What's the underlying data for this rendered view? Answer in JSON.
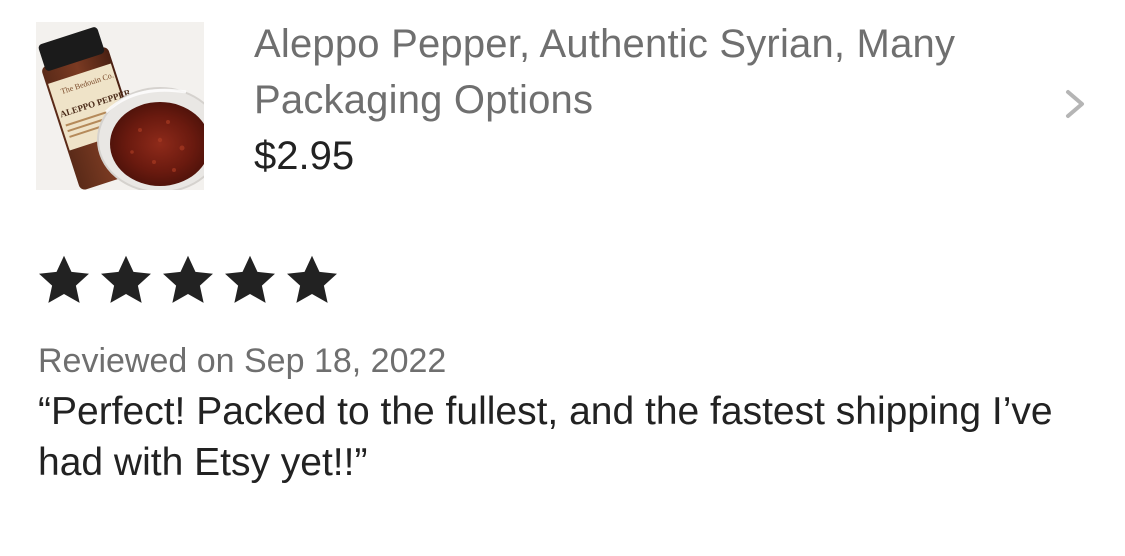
{
  "listing": {
    "title": "Aleppo Pepper, Authentic Syrian, Many Packaging Options",
    "price": "$2.95",
    "thumbnail": {
      "label_line1": "The Bedouin Co.",
      "label_line2": "ALEPPO PEPPER"
    },
    "chevron_icon": "chevron-right-icon"
  },
  "review": {
    "rating": 5,
    "rating_max": 5,
    "star_icon": "star-icon",
    "star_color": "#222222",
    "date_text": "Reviewed on Sep 18, 2022",
    "text": "“Perfect! Packed to the fullest, and the fastest shipping I’ve had with Etsy yet!!”"
  },
  "colors": {
    "title": "#6f6f6f",
    "price": "#222222",
    "date": "#6f6f6f",
    "body": "#222222",
    "chevron": "#b5b5b5"
  }
}
